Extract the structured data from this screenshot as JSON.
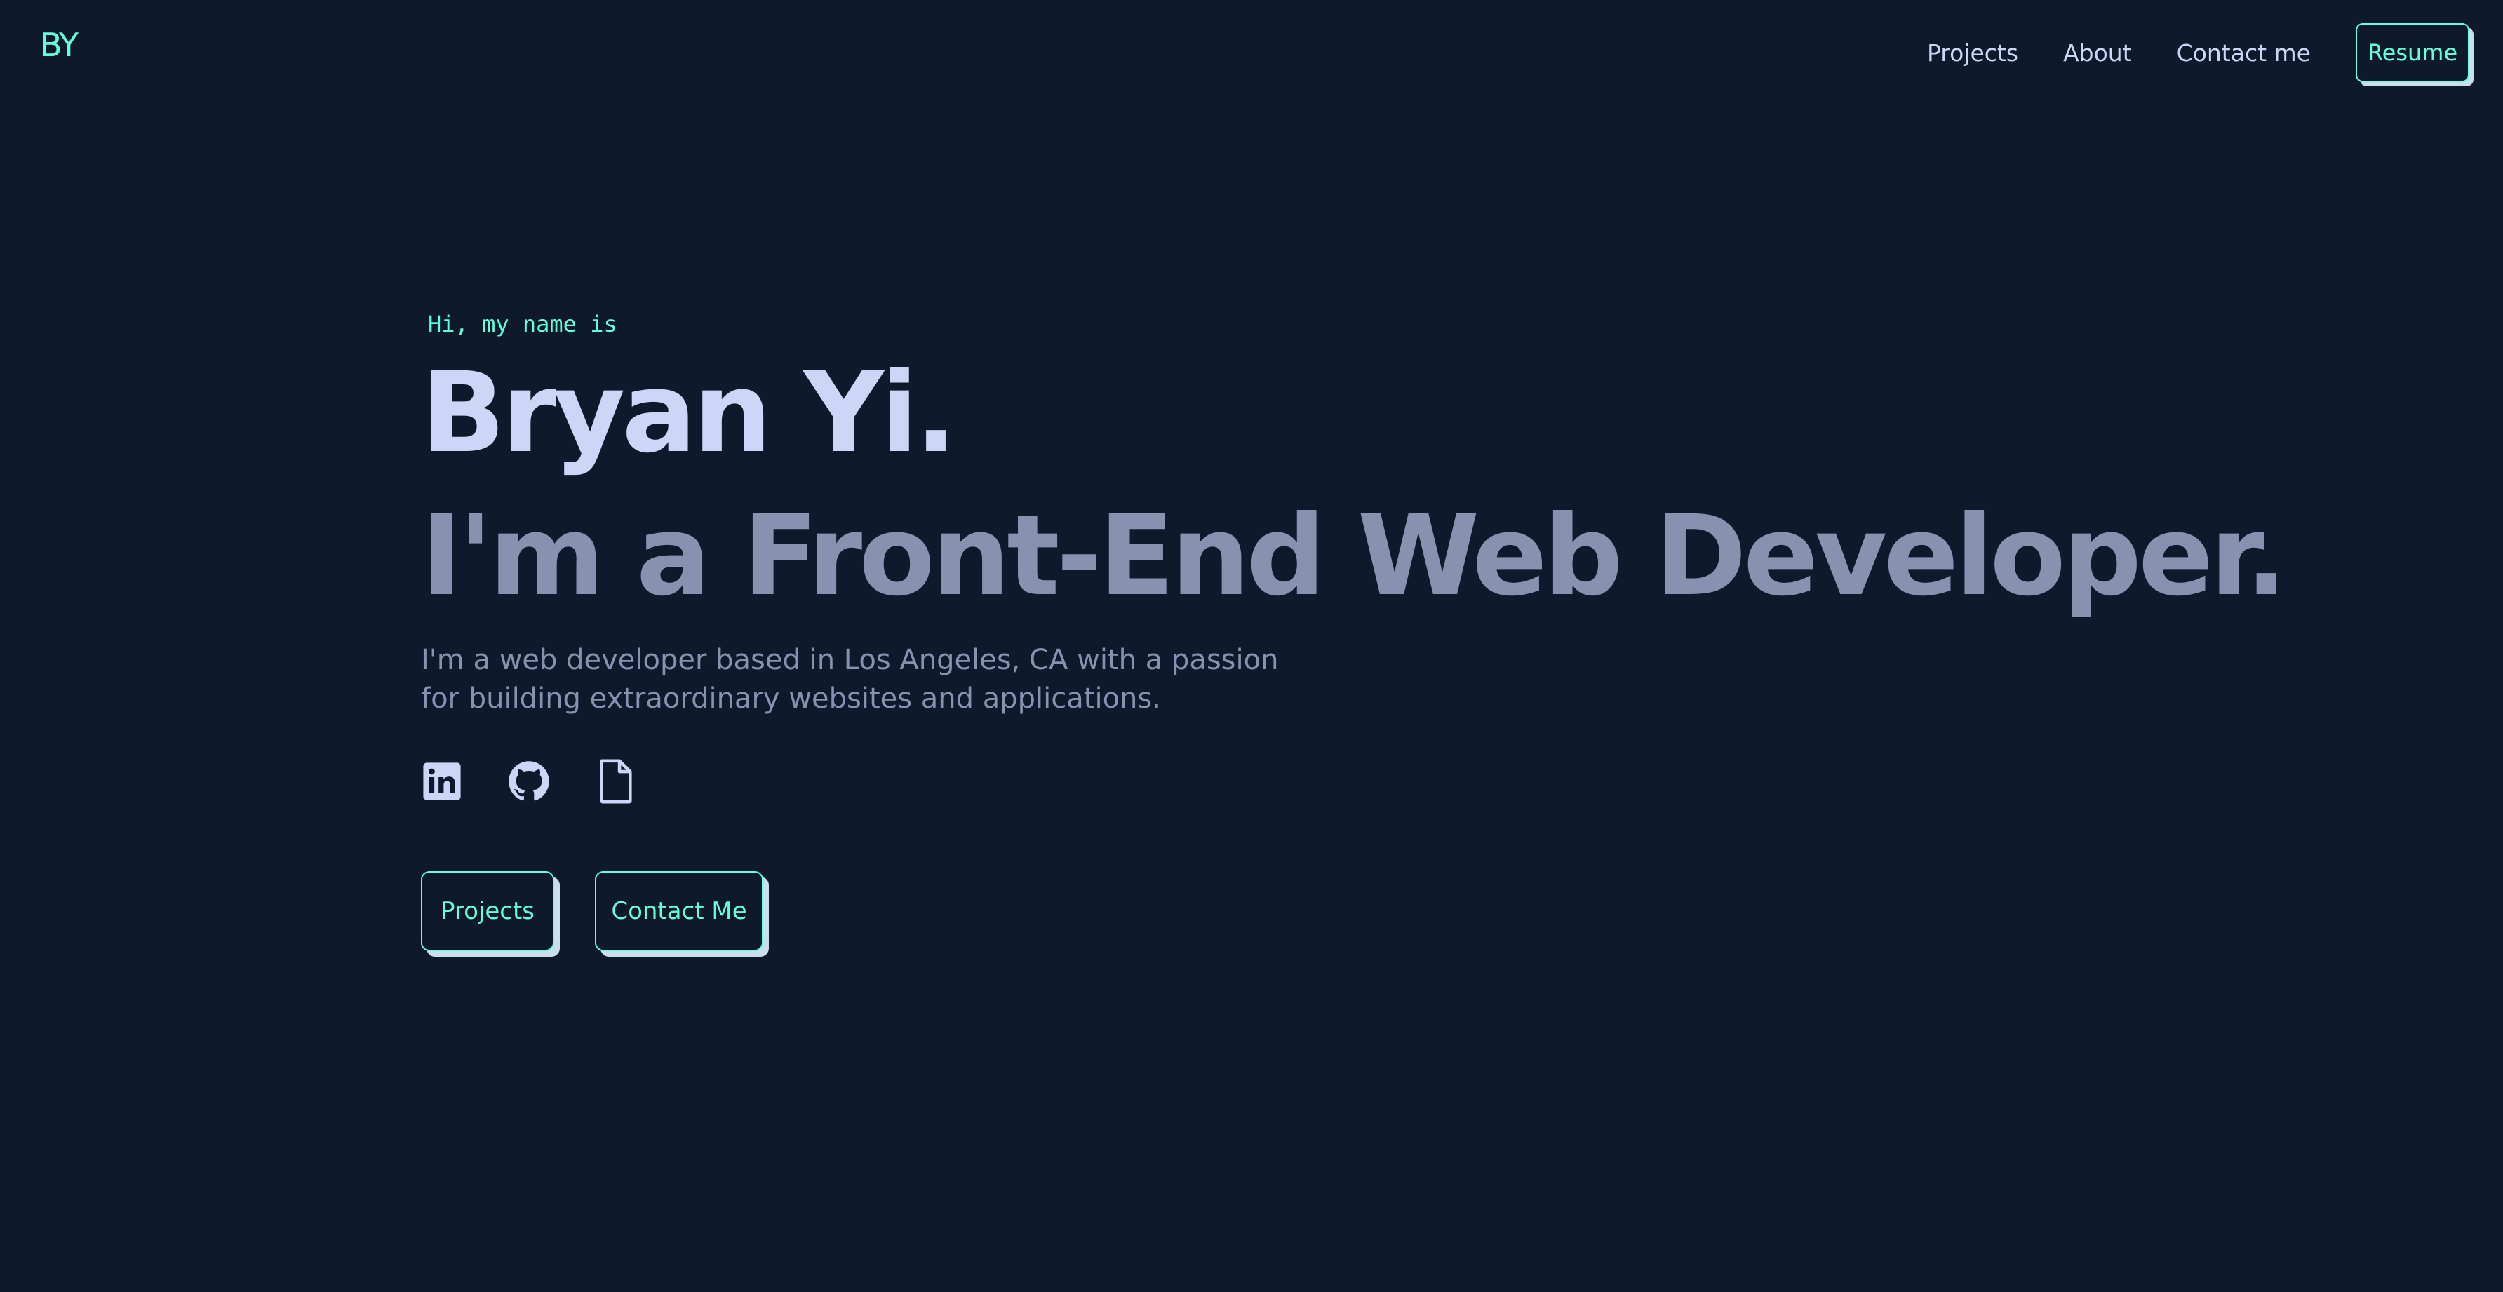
{
  "header": {
    "logo": "BY",
    "nav": [
      {
        "label": "Projects"
      },
      {
        "label": "About"
      },
      {
        "label": "Contact me"
      }
    ],
    "resume_label": "Resume"
  },
  "hero": {
    "greeting": "Hi, my name is",
    "name": "Bryan Yi.",
    "tagline": "I'm a Front-End Web Developer.",
    "bio": "I'm a web developer based in Los Angeles, CA with a passion for building extraordinary websites and applications.",
    "socials": [
      {
        "icon": "linkedin-icon"
      },
      {
        "icon": "github-icon"
      },
      {
        "icon": "file-icon"
      }
    ],
    "buttons": {
      "projects_label": "Projects",
      "contact_label": "Contact Me"
    }
  },
  "colors": {
    "background": "#0f192c",
    "accent": "#64ffda",
    "heading": "#ccd6f6",
    "muted": "#8892b0",
    "button_shadow": "#c9dfef"
  }
}
